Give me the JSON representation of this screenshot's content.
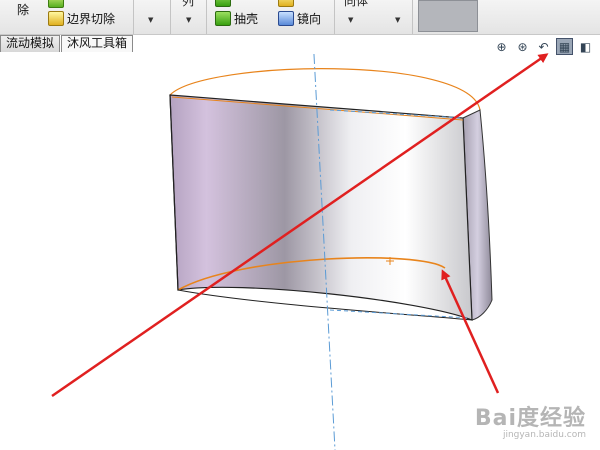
{
  "ribbon": {
    "delete_label": "除",
    "boundary_cut_label": "边界切除",
    "shell_label": "抽壳",
    "mirror_label": "镜向",
    "pattern_label_partial": "列",
    "body_label_partial": "同体",
    "dropdown_glyph": "▼"
  },
  "tabs": [
    {
      "label": "流动模拟"
    },
    {
      "label": "沐风工具箱"
    }
  ],
  "hud": {
    "zoom_fit_glyph": "⊕",
    "zoom_area_glyph": "⊛",
    "prev_view_glyph": "↶",
    "section_view_glyph": "▦",
    "view_orientation_glyph": "◧"
  },
  "watermark": {
    "logo": "Bai度经验",
    "url": "jingyan.baidu.com"
  },
  "colors": {
    "arrow": "#e02020",
    "edge_highlight": "#e8841c",
    "axis": "#5b9bd5"
  }
}
